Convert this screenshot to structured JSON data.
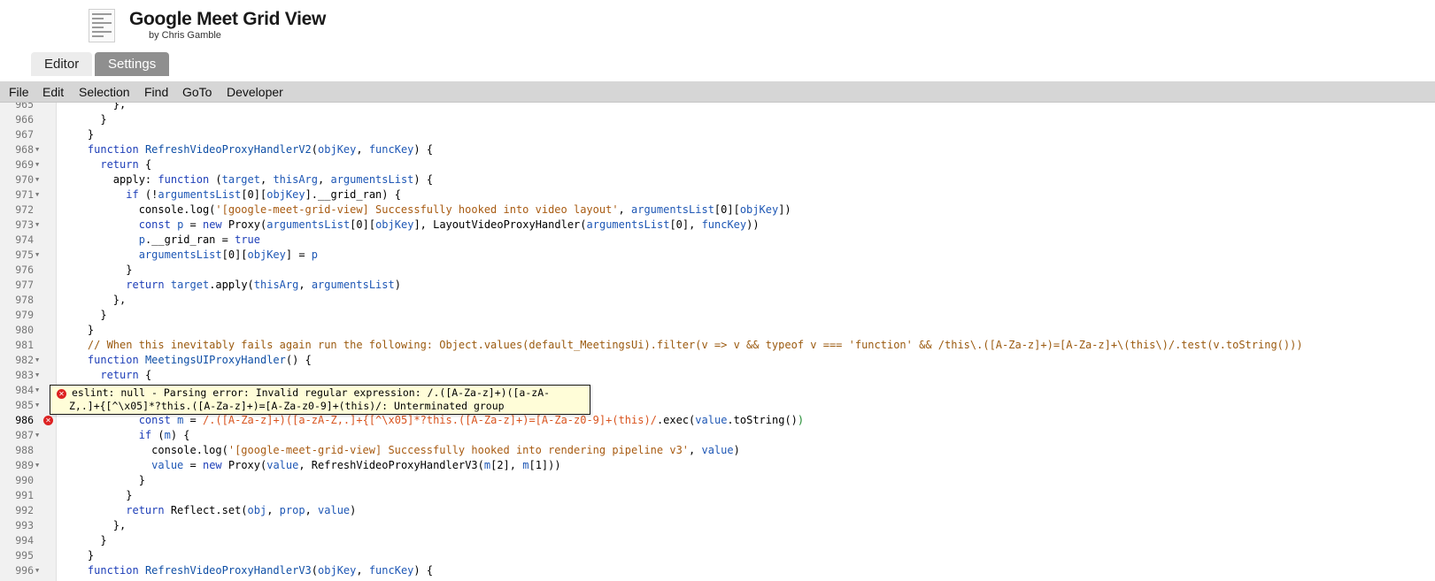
{
  "header": {
    "title": "Google Meet Grid View",
    "author": "by Chris Gamble"
  },
  "tabs": [
    {
      "label": "Editor",
      "active": false
    },
    {
      "label": "Settings",
      "active": true
    }
  ],
  "menu": [
    "File",
    "Edit",
    "Selection",
    "Find",
    "GoTo",
    "Developer"
  ],
  "editor": {
    "active_line": "986",
    "lines": [
      {
        "n": "965",
        "fold": false,
        "error": false
      },
      {
        "n": "966",
        "fold": false,
        "error": false
      },
      {
        "n": "967",
        "fold": false,
        "error": false
      },
      {
        "n": "968",
        "fold": true,
        "error": false
      },
      {
        "n": "969",
        "fold": true,
        "error": false
      },
      {
        "n": "970",
        "fold": true,
        "error": false
      },
      {
        "n": "971",
        "fold": true,
        "error": false
      },
      {
        "n": "972",
        "fold": false,
        "error": false
      },
      {
        "n": "973",
        "fold": true,
        "error": false
      },
      {
        "n": "974",
        "fold": false,
        "error": false
      },
      {
        "n": "975",
        "fold": true,
        "error": false
      },
      {
        "n": "976",
        "fold": false,
        "error": false
      },
      {
        "n": "977",
        "fold": false,
        "error": false
      },
      {
        "n": "978",
        "fold": false,
        "error": false
      },
      {
        "n": "979",
        "fold": false,
        "error": false
      },
      {
        "n": "980",
        "fold": false,
        "error": false
      },
      {
        "n": "981",
        "fold": false,
        "error": false
      },
      {
        "n": "982",
        "fold": true,
        "error": false
      },
      {
        "n": "983",
        "fold": true,
        "error": false
      },
      {
        "n": "984",
        "fold": true,
        "error": false
      },
      {
        "n": "985",
        "fold": true,
        "error": false
      },
      {
        "n": "986",
        "fold": false,
        "error": true
      },
      {
        "n": "987",
        "fold": true,
        "error": false
      },
      {
        "n": "988",
        "fold": false,
        "error": false
      },
      {
        "n": "989",
        "fold": true,
        "error": false
      },
      {
        "n": "990",
        "fold": false,
        "error": false
      },
      {
        "n": "991",
        "fold": false,
        "error": false
      },
      {
        "n": "992",
        "fold": false,
        "error": false
      },
      {
        "n": "993",
        "fold": false,
        "error": false
      },
      {
        "n": "994",
        "fold": false,
        "error": false
      },
      {
        "n": "995",
        "fold": false,
        "error": false
      },
      {
        "n": "996",
        "fold": true,
        "error": false
      }
    ],
    "code": [
      [
        [
          "p",
          "        },"
        ]
      ],
      [
        [
          "p",
          "      }"
        ]
      ],
      [
        [
          "p",
          "    }"
        ]
      ],
      [
        [
          "p",
          "    "
        ],
        [
          "kw",
          "function "
        ],
        [
          "fn",
          "RefreshVideoProxyHandlerV2"
        ],
        [
          "p",
          "("
        ],
        [
          "var",
          "objKey"
        ],
        [
          "p",
          ", "
        ],
        [
          "var",
          "funcKey"
        ],
        [
          "p",
          ") {"
        ]
      ],
      [
        [
          "p",
          "      "
        ],
        [
          "kw",
          "return"
        ],
        [
          "p",
          " {"
        ]
      ],
      [
        [
          "p",
          "        apply: "
        ],
        [
          "kw",
          "function"
        ],
        [
          "p",
          " ("
        ],
        [
          "var",
          "target"
        ],
        [
          "p",
          ", "
        ],
        [
          "var",
          "thisArg"
        ],
        [
          "p",
          ", "
        ],
        [
          "var",
          "argumentsList"
        ],
        [
          "p",
          ") {"
        ]
      ],
      [
        [
          "p",
          "          "
        ],
        [
          "kw",
          "if"
        ],
        [
          "p",
          " (!"
        ],
        [
          "var",
          "argumentsList"
        ],
        [
          "p",
          "[0]["
        ],
        [
          "var",
          "objKey"
        ],
        [
          "p",
          "].__grid_ran) {"
        ]
      ],
      [
        [
          "p",
          "            console.log("
        ],
        [
          "str",
          "'[google-meet-grid-view] Successfully hooked into video layout'"
        ],
        [
          "p",
          ", "
        ],
        [
          "var",
          "argumentsList"
        ],
        [
          "p",
          "[0]["
        ],
        [
          "var",
          "objKey"
        ],
        [
          "p",
          "])"
        ]
      ],
      [
        [
          "p",
          "            "
        ],
        [
          "kw",
          "const"
        ],
        [
          "p",
          " "
        ],
        [
          "var",
          "p"
        ],
        [
          "p",
          " = "
        ],
        [
          "kw",
          "new"
        ],
        [
          "p",
          " Proxy("
        ],
        [
          "var",
          "argumentsList"
        ],
        [
          "p",
          "[0]["
        ],
        [
          "var",
          "objKey"
        ],
        [
          "p",
          "], LayoutVideoProxyHandler("
        ],
        [
          "var",
          "argumentsList"
        ],
        [
          "p",
          "[0], "
        ],
        [
          "var",
          "funcKey"
        ],
        [
          "p",
          "))"
        ]
      ],
      [
        [
          "p",
          "            "
        ],
        [
          "var",
          "p"
        ],
        [
          "p",
          ".__grid_ran = "
        ],
        [
          "kw",
          "true"
        ]
      ],
      [
        [
          "p",
          "            "
        ],
        [
          "var",
          "argumentsList"
        ],
        [
          "p",
          "[0]["
        ],
        [
          "var",
          "objKey"
        ],
        [
          "p",
          "] = "
        ],
        [
          "var",
          "p"
        ]
      ],
      [
        [
          "p",
          "          }"
        ]
      ],
      [
        [
          "p",
          "          "
        ],
        [
          "kw",
          "return"
        ],
        [
          "p",
          " "
        ],
        [
          "var",
          "target"
        ],
        [
          "p",
          ".apply("
        ],
        [
          "var",
          "thisArg"
        ],
        [
          "p",
          ", "
        ],
        [
          "var",
          "argumentsList"
        ],
        [
          "p",
          ")"
        ]
      ],
      [
        [
          "p",
          "        },"
        ]
      ],
      [
        [
          "p",
          "      }"
        ]
      ],
      [
        [
          "p",
          "    }"
        ]
      ],
      [
        [
          "com",
          "    // When this inevitably fails again run the following: Object.values(default_MeetingsUi).filter(v => v && typeof v === 'function' && /this\\.([A-Za-z]+)=[A-Za-z]+\\(this\\)/.test(v.toString()))"
        ]
      ],
      [
        [
          "p",
          "    "
        ],
        [
          "kw",
          "function "
        ],
        [
          "fn",
          "MeetingsUIProxyHandler"
        ],
        [
          "p",
          "() {"
        ]
      ],
      [
        [
          "p",
          "      "
        ],
        [
          "kw",
          "return"
        ],
        [
          "p",
          " {"
        ]
      ],
      [
        [
          "p",
          ""
        ]
      ],
      [
        [
          "p",
          ""
        ]
      ],
      [
        [
          "p",
          "            "
        ],
        [
          "kw",
          "const"
        ],
        [
          "p",
          " "
        ],
        [
          "var",
          "m"
        ],
        [
          "p",
          " = "
        ],
        [
          "re",
          "/.([A-Za-z]+)([a-zA-Z,.]+{[^\\x05]*?this.([A-Za-z]+)=[A-Za-z0-9]+(this)/"
        ],
        [
          "p",
          ".exec("
        ],
        [
          "var",
          "value"
        ],
        [
          "p",
          ".toString()"
        ],
        [
          "gr",
          ")"
        ]
      ],
      [
        [
          "p",
          "            "
        ],
        [
          "kw",
          "if"
        ],
        [
          "p",
          " ("
        ],
        [
          "var",
          "m"
        ],
        [
          "p",
          ") {"
        ]
      ],
      [
        [
          "p",
          "              console.log("
        ],
        [
          "str",
          "'[google-meet-grid-view] Successfully hooked into rendering pipeline v3'"
        ],
        [
          "p",
          ", "
        ],
        [
          "var",
          "value"
        ],
        [
          "p",
          ")"
        ]
      ],
      [
        [
          "p",
          "              "
        ],
        [
          "var",
          "value"
        ],
        [
          "p",
          " = "
        ],
        [
          "kw",
          "new"
        ],
        [
          "p",
          " Proxy("
        ],
        [
          "var",
          "value"
        ],
        [
          "p",
          ", RefreshVideoProxyHandlerV3("
        ],
        [
          "var",
          "m"
        ],
        [
          "p",
          "[2], "
        ],
        [
          "var",
          "m"
        ],
        [
          "p",
          "[1]))"
        ]
      ],
      [
        [
          "p",
          "            }"
        ]
      ],
      [
        [
          "p",
          "          }"
        ]
      ],
      [
        [
          "p",
          "          "
        ],
        [
          "kw",
          "return"
        ],
        [
          "p",
          " Reflect.set("
        ],
        [
          "var",
          "obj"
        ],
        [
          "p",
          ", "
        ],
        [
          "var",
          "prop"
        ],
        [
          "p",
          ", "
        ],
        [
          "var",
          "value"
        ],
        [
          "p",
          ")"
        ]
      ],
      [
        [
          "p",
          "        },"
        ]
      ],
      [
        [
          "p",
          "      }"
        ]
      ],
      [
        [
          "p",
          "    }"
        ]
      ],
      [
        [
          "p",
          "    "
        ],
        [
          "kw",
          "function "
        ],
        [
          "fn",
          "RefreshVideoProxyHandlerV3"
        ],
        [
          "p",
          "("
        ],
        [
          "var",
          "objKey"
        ],
        [
          "p",
          ", "
        ],
        [
          "var",
          "funcKey"
        ],
        [
          "p",
          ") {"
        ]
      ]
    ]
  },
  "lint_tooltip": {
    "line1": "eslint: null - Parsing error: Invalid regular expression: /.([A-Za-z]+)([a-zA-",
    "line2": "Z,.]+{[^\\x05]*?this.([A-Za-z]+)=[A-Za-z0-9]+(this)/: Unterminated group"
  },
  "icons": {
    "fold": "fold-arrow-icon",
    "error": "error-icon",
    "extension": "extension-logo-icon"
  },
  "colors": {
    "keyword": "#1d3eb8",
    "string": "#a85b12",
    "comment": "#9b5a0f",
    "regex": "#d9541e",
    "error": "#dd2222",
    "tab_active": "#8f8f8f",
    "menubar": "#d6d6d6",
    "tooltip_bg": "#fffdd8"
  }
}
